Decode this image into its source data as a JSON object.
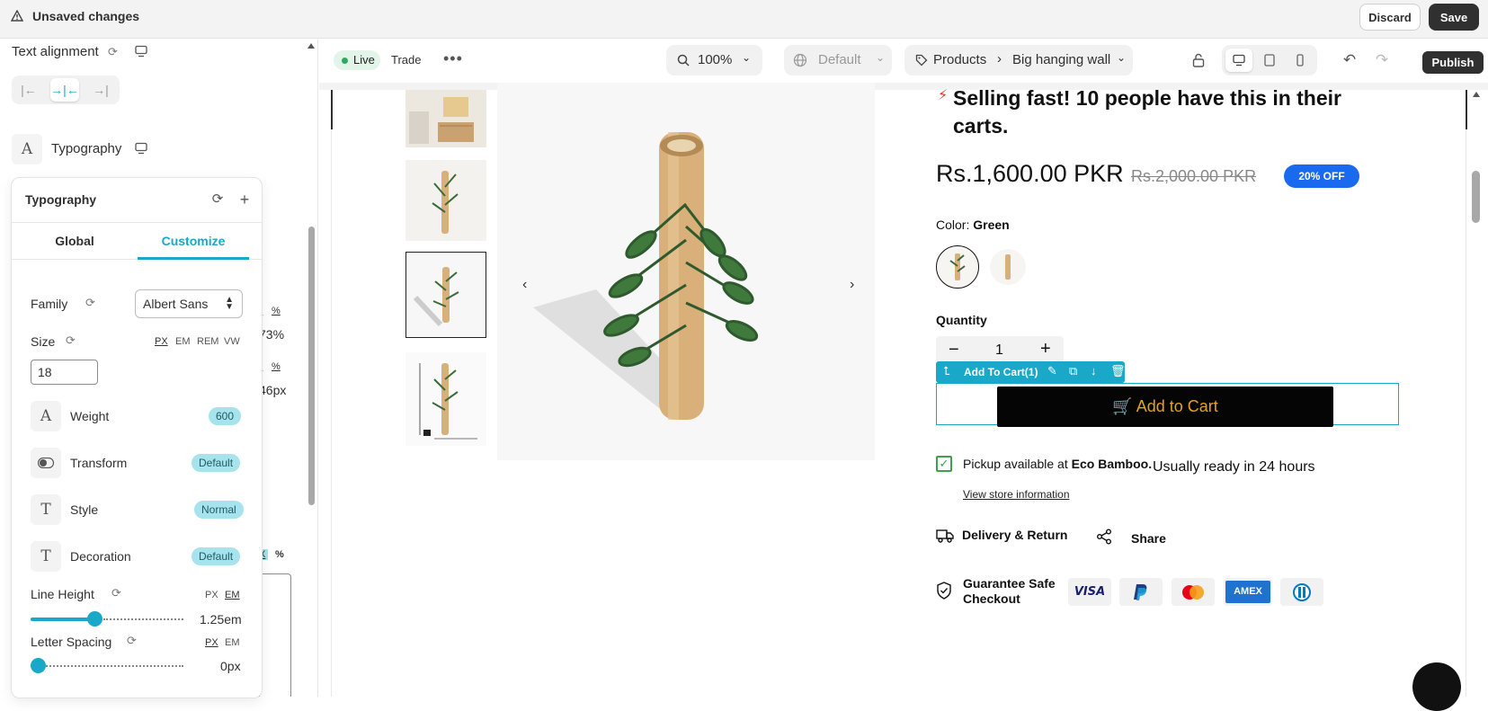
{
  "topbar": {
    "title": "Unsaved changes",
    "discard": "Discard",
    "save": "Save"
  },
  "left_panel": {
    "text_alignment": "Text alignment",
    "typography_row": "Typography",
    "background_fragments": [
      "X",
      "%",
      "73%",
      "X",
      "%",
      "46px",
      "X",
      "%"
    ]
  },
  "popover": {
    "title": "Typography",
    "tabs": [
      "Global",
      "Customize"
    ],
    "active_tab": "Customize",
    "family_label": "Family",
    "family_value": "Albert Sans",
    "size_label": "Size",
    "size_units": [
      "PX",
      "EM",
      "REM",
      "VW"
    ],
    "size_unit_active": "PX",
    "size_value": "18",
    "weight": {
      "label": "Weight",
      "value": "600"
    },
    "transform": {
      "label": "Transform",
      "value": "Default"
    },
    "style": {
      "label": "Style",
      "value": "Normal"
    },
    "decoration": {
      "label": "Decoration",
      "value": "Default"
    },
    "line_height": {
      "label": "Line Height",
      "units": [
        "PX",
        "EM"
      ],
      "unit_active": "EM",
      "value": "1.25em",
      "level": 0.42
    },
    "letter_spacing": {
      "label": "Letter Spacing",
      "units": [
        "PX",
        "EM"
      ],
      "unit_active": "PX",
      "value": "0px",
      "level": 0.0
    }
  },
  "editor_toolbar": {
    "status": "Live",
    "trade": "Trade",
    "zoom": "100%",
    "locale": "Default",
    "breadcrumb": [
      "Products",
      "Big hanging wall"
    ],
    "publish": "Publish"
  },
  "product": {
    "urgency": "Selling fast! 10 people have this in their carts.",
    "price": "Rs.1,600.00 PKR",
    "compare_price": "Rs.2,000.00 PKR",
    "discount": "20% OFF",
    "color_label": "Color:",
    "color_value": "Green",
    "quantity_label": "Quantity",
    "quantity": "1",
    "selected_block": "Add To Cart(1)",
    "add_to_cart": "Add to Cart",
    "pickup_text": "Pickup available at",
    "pickup_store": "Eco Bamboo.",
    "ready_text": "Usually ready in 24 hours",
    "store_link": "View store information",
    "delivery": "Delivery & Return",
    "share": "Share",
    "guarantee": "Guarantee Safe Checkout",
    "payments": [
      "VISA",
      "PayPal",
      "Mastercard",
      "AMEX",
      "Diners"
    ]
  },
  "colors": {
    "accent": "#1aa8c9",
    "badge_bg": "#a6e3ec",
    "discount": "#1a6aef",
    "cart_text": "#e5a21f"
  }
}
